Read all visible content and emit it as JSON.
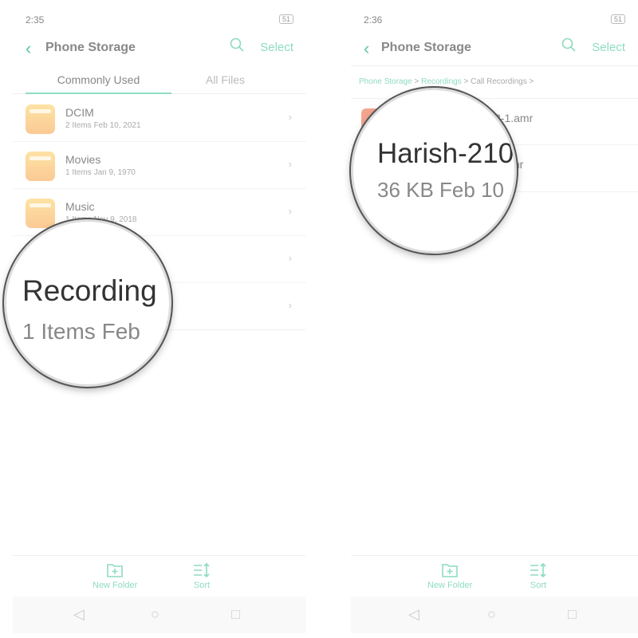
{
  "left": {
    "status_time": "2:35",
    "battery": "51",
    "title": "Phone Storage",
    "select_label": "Select",
    "tabs": [
      "Commonly Used",
      "All Files"
    ],
    "folders": [
      {
        "name": "DCIM",
        "meta": "2 Items  Feb 10, 2021"
      },
      {
        "name": "Movies",
        "meta": "1 Items  Jan 9, 1970"
      },
      {
        "name": "Music",
        "meta": "1 Items  Nov 9, 2018"
      }
    ],
    "magnifier": {
      "name": "Recording",
      "meta": "1 Items  Feb"
    },
    "bottom": {
      "new_folder": "New Folder",
      "sort": "Sort"
    }
  },
  "right": {
    "status_time": "2:36",
    "battery": "51",
    "title": "Phone Storage",
    "select_label": "Select",
    "breadcrumb": [
      "Phone Storage",
      "Recordings",
      "Call Recordings"
    ],
    "files": [
      {
        "name": "3-1.amr"
      },
      {
        "name": "mr"
      }
    ],
    "magnifier": {
      "name": "Harish-210",
      "meta": "36 KB  Feb 10"
    },
    "bottom": {
      "new_folder": "New Folder",
      "sort": "Sort"
    }
  },
  "colors": {
    "accent": "#5cc9a0",
    "folder": "#fbd59b",
    "file": "#f4a58f"
  }
}
